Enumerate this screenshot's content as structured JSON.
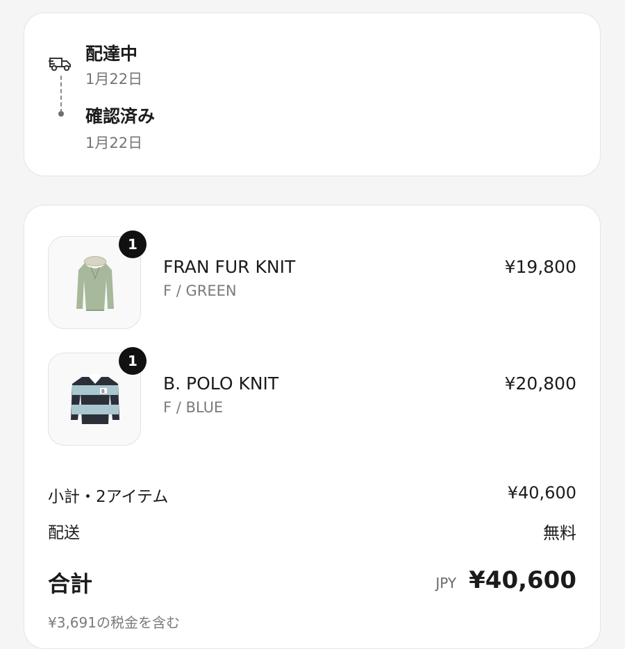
{
  "status": {
    "steps": [
      {
        "title": "配達中",
        "date": "1月22日",
        "icon": "truck-icon"
      },
      {
        "title": "確認済み",
        "date": "1月22日",
        "icon": "dot"
      }
    ]
  },
  "items": [
    {
      "name": "FRAN FUR KNIT",
      "variant": "F / GREEN",
      "price": "¥19,800",
      "quantity": "1",
      "image_icon": "green-knit-sweater-image"
    },
    {
      "name": "B. POLO KNIT",
      "variant": "F / BLUE",
      "price": "¥20,800",
      "quantity": "1",
      "image_icon": "striped-polo-knit-image"
    }
  ],
  "summary": {
    "subtotal_label": "小計・2アイテム",
    "subtotal_value": "¥40,600",
    "shipping_label": "配送",
    "shipping_value": "無料",
    "total_label": "合計",
    "currency": "JPY",
    "total_value": "¥40,600",
    "tax_note": "¥3,691の税金を含む"
  },
  "colors": {
    "background": "#f5f5f5",
    "card": "#ffffff",
    "text": "#1b1b1b",
    "muted": "#7a7a7a",
    "badge": "#111111"
  }
}
